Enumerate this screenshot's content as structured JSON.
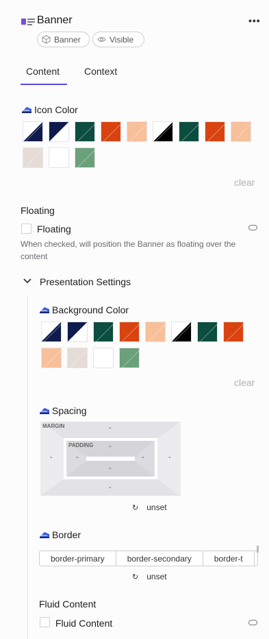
{
  "header": {
    "title": "Banner",
    "more_label": "•••"
  },
  "chips": [
    {
      "label": "Banner"
    },
    {
      "label": "Visible"
    }
  ],
  "tabs": [
    {
      "label": "Content"
    },
    {
      "label": "Context"
    }
  ],
  "icon_color": {
    "label": "Icon Color",
    "clear_label": "clear",
    "swatches": [
      {
        "name": "navy-white-split",
        "c1": "#ffffff",
        "c2": "#0f1b4c"
      },
      {
        "name": "white-navy-split",
        "c1": "#0f1b4c",
        "c2": "#ffffff"
      },
      {
        "name": "dark-green",
        "c1": "#0b4d3e",
        "c2": "#0b4d3e"
      },
      {
        "name": "orange",
        "c1": "#d94310",
        "c2": "#d94310"
      },
      {
        "name": "peach",
        "c1": "#f7c09a",
        "c2": "#f7c09a"
      },
      {
        "name": "white-black-split",
        "c1": "#ffffff",
        "c2": "#000000"
      },
      {
        "name": "dark-green-2",
        "c1": "#0b4d3e",
        "c2": "#0b4d3e"
      },
      {
        "name": "orange-2",
        "c1": "#d94310",
        "c2": "#d94310"
      },
      {
        "name": "peach-2",
        "c1": "#f7c09a",
        "c2": "#f7c09a"
      },
      {
        "name": "beige",
        "c1": "#e6dcd6",
        "c2": "#e6dcd6"
      },
      {
        "name": "white",
        "c1": "#ffffff",
        "c2": "#ffffff"
      },
      {
        "name": "sage-green",
        "c1": "#6aa07a",
        "c2": "#6aa07a"
      }
    ]
  },
  "floating": {
    "heading": "Floating",
    "label": "Floating",
    "help": "When checked, will position the Banner as floating over the content"
  },
  "presentation": {
    "label": "Presentation Settings"
  },
  "background_color": {
    "label": "Background Color",
    "clear_label": "clear",
    "swatches": [
      {
        "name": "navy-white-split",
        "c1": "#ffffff",
        "c2": "#0f1b4c"
      },
      {
        "name": "white-navy-split",
        "c1": "#0f1b4c",
        "c2": "#ffffff"
      },
      {
        "name": "dark-green",
        "c1": "#0b4d3e",
        "c2": "#0b4d3e"
      },
      {
        "name": "orange",
        "c1": "#d94310",
        "c2": "#d94310"
      },
      {
        "name": "peach",
        "c1": "#f7c09a",
        "c2": "#f7c09a"
      },
      {
        "name": "white-black-split",
        "c1": "#ffffff",
        "c2": "#000000"
      },
      {
        "name": "dark-green-2",
        "c1": "#0b4d3e",
        "c2": "#0b4d3e"
      },
      {
        "name": "orange-2",
        "c1": "#d94310",
        "c2": "#d94310"
      },
      {
        "name": "peach-2",
        "c1": "#f7c09a",
        "c2": "#f7c09a"
      },
      {
        "name": "beige",
        "c1": "#e6dcd6",
        "c2": "#e6dcd6"
      },
      {
        "name": "white",
        "c1": "#ffffff",
        "c2": "#ffffff"
      },
      {
        "name": "sage-green",
        "c1": "#6aa07a",
        "c2": "#6aa07a"
      }
    ]
  },
  "spacing": {
    "label": "Spacing",
    "margin_label": "MARGIN",
    "padding_label": "PADDING",
    "dash": "-",
    "unset_label": "unset"
  },
  "border": {
    "label": "Border",
    "options": [
      "border-primary",
      "border-secondary",
      "border-t"
    ],
    "unset_label": "unset"
  },
  "fluid": {
    "heading": "Fluid Content",
    "label": "Fluid Content"
  },
  "colors": {
    "accent": "#5b4bd6"
  }
}
